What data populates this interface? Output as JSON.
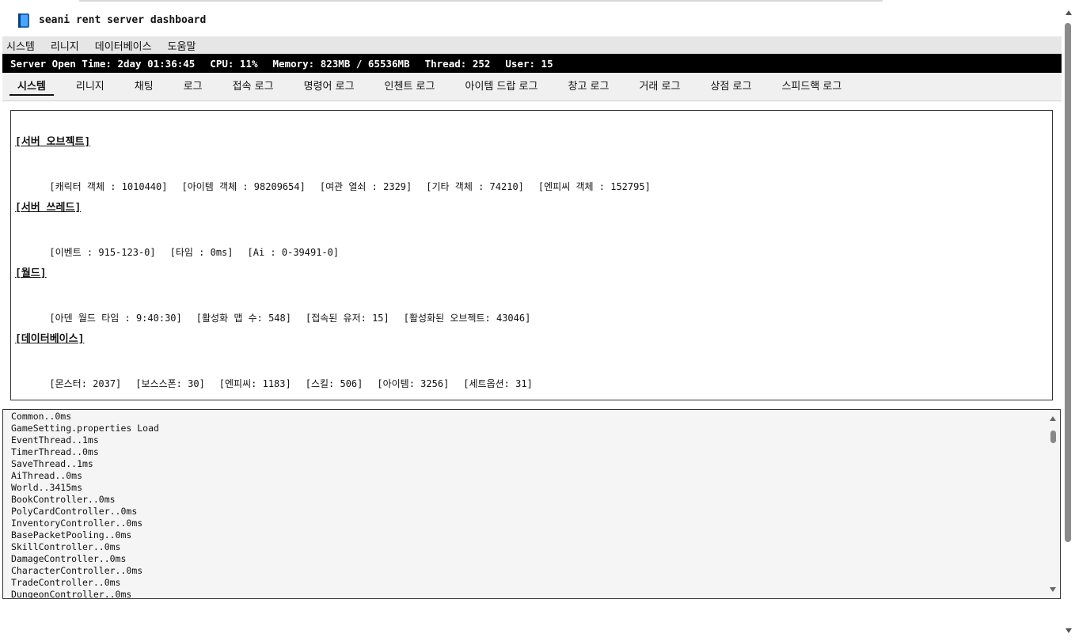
{
  "window": {
    "title": "seani rent server dashboard"
  },
  "menu": [
    "시스템",
    "리니지",
    "데이터베이스",
    "도움말"
  ],
  "status": {
    "open_time": "Server Open Time: 2day 01:36:45",
    "cpu": "CPU: 11%",
    "memory": "Memory: 823MB / 65536MB",
    "thread": "Thread: 252",
    "user": "User: 15"
  },
  "tabs": [
    "시스템",
    "리니지",
    "채팅",
    "로그",
    "접속 로그",
    "명령어 로그",
    "인첸트 로그",
    "아이템 드랍 로그",
    "창고 로그",
    "거래 로그",
    "상점 로그",
    "스피드핵 로그"
  ],
  "active_tab": "시스템",
  "sections": [
    {
      "title": "[서버 오브젝트]",
      "items": [
        "[캐릭터 객체 : 1010440]",
        "[아이템 객체 : 98209654]",
        "[여관 열쇠 : 2329]",
        "[기타 객체 : 74210]",
        "[엔피씨 객체 : 152795]"
      ]
    },
    {
      "title": "[서버 쓰레드]",
      "items": [
        "[이벤트 : 915-123-0]",
        "[타임 : 0ms]",
        "[Ai : 0-39491-0]"
      ]
    },
    {
      "title": "[월드]",
      "items": [
        "[아덴 월드 타임 : 9:40:30]",
        "[활성화 맵 수: 548]",
        "[접속된 유저: 15]",
        "[활성화된 오브젝트: 43046]"
      ]
    },
    {
      "title": "[데이터베이스]",
      "items": [
        "[몬스터: 2037]",
        "[보스스폰: 30]",
        "[엔피씨: 1183]",
        "[스킬: 506]",
        "[아이템: 3256]",
        "[세트옵션: 31]"
      ]
    }
  ],
  "log_lines": [
    "Common..0ms",
    "GameSetting.properties Load",
    "EventThread..1ms",
    "TimerThread..0ms",
    "SaveThread..1ms",
    "AiThread..0ms",
    "World..3415ms",
    "BookController..0ms",
    "PolyCardController..0ms",
    "InventoryController..0ms",
    "BasePacketPooling..0ms",
    "SkillController..0ms",
    "DamageController..0ms",
    "CharacterController..0ms",
    "TradeController..0ms",
    "DungeonController..0ms"
  ]
}
